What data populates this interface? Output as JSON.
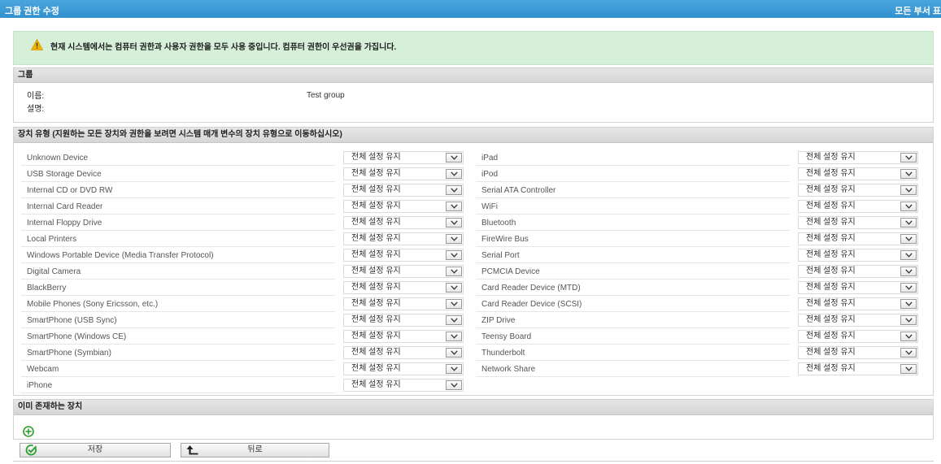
{
  "header": {
    "title": "그룹 권한 수정",
    "right_link": "모든 부서 표"
  },
  "warning": {
    "icon": "warning-icon",
    "text": "현재 시스템에서는 컴퓨터 권한과 사용자 권한을 모두 사용 중입니다. 컴퓨터 권한이 우선권을 가집니다."
  },
  "group_section": {
    "title": "그룹",
    "name_label": "이름:",
    "name_value": "Test group",
    "description_label": "설명:"
  },
  "device_section": {
    "title": "장치 유형 (지원하는 모든 장치와 권한을 보려면 시스템 매개 변수의 장치 유형으로 이동하십시오)",
    "left_devices": [
      {
        "name": "Unknown Device",
        "setting": "전체 설정 유지"
      },
      {
        "name": "USB Storage Device",
        "setting": "전체 설정 유지"
      },
      {
        "name": "Internal CD or DVD RW",
        "setting": "전체 설정 유지"
      },
      {
        "name": "Internal Card Reader",
        "setting": "전체 설정 유지"
      },
      {
        "name": "Internal Floppy Drive",
        "setting": "전체 설정 유지"
      },
      {
        "name": "Local Printers",
        "setting": "전체 설정 유지"
      },
      {
        "name": "Windows Portable Device (Media Transfer Protocol)",
        "setting": "전체 설정 유지"
      },
      {
        "name": "Digital Camera",
        "setting": "전체 설정 유지"
      },
      {
        "name": "BlackBerry",
        "setting": "전체 설정 유지"
      },
      {
        "name": "Mobile Phones (Sony Ericsson, etc.)",
        "setting": "전체 설정 유지"
      },
      {
        "name": "SmartPhone (USB Sync)",
        "setting": "전체 설정 유지"
      },
      {
        "name": "SmartPhone (Windows CE)",
        "setting": "전체 설정 유지"
      },
      {
        "name": "SmartPhone (Symbian)",
        "setting": "전체 설정 유지"
      },
      {
        "name": "Webcam",
        "setting": "전체 설정 유지"
      },
      {
        "name": "iPhone",
        "setting": "전체 설정 유지"
      }
    ],
    "right_devices": [
      {
        "name": "iPad",
        "setting": "전체 설정 유지"
      },
      {
        "name": "iPod",
        "setting": "전체 설정 유지"
      },
      {
        "name": "Serial ATA Controller",
        "setting": "전체 설정 유지"
      },
      {
        "name": "WiFi",
        "setting": "전체 설정 유지"
      },
      {
        "name": "Bluetooth",
        "setting": "전체 설정 유지"
      },
      {
        "name": "FireWire Bus",
        "setting": "전체 설정 유지"
      },
      {
        "name": "Serial Port",
        "setting": "전체 설정 유지"
      },
      {
        "name": "PCMCIA Device",
        "setting": "전체 설정 유지"
      },
      {
        "name": "Card Reader Device (MTD)",
        "setting": "전체 설정 유지"
      },
      {
        "name": "Card Reader Device (SCSI)",
        "setting": "전체 설정 유지"
      },
      {
        "name": "ZIP Drive",
        "setting": "전체 설정 유지"
      },
      {
        "name": "Teensy Board",
        "setting": "전체 설정 유지"
      },
      {
        "name": "Thunderbolt",
        "setting": "전체 설정 유지"
      },
      {
        "name": "Network Share",
        "setting": "전체 설정 유지"
      }
    ]
  },
  "existing_section": {
    "title": "이미 존재하는 장치",
    "add_icon": "add-circle-icon"
  },
  "buttons": {
    "save_label": "저장",
    "save_icon": "check-circle-icon",
    "back_label": "뒤로",
    "back_icon": "back-arrow-icon"
  },
  "colors": {
    "header_bg": "#3399d9",
    "warning_bg": "#d5efd9",
    "section_header_bg": "#dcdcdc",
    "warning_icon": "#f2b400",
    "green_icon": "#2e9e2e"
  }
}
